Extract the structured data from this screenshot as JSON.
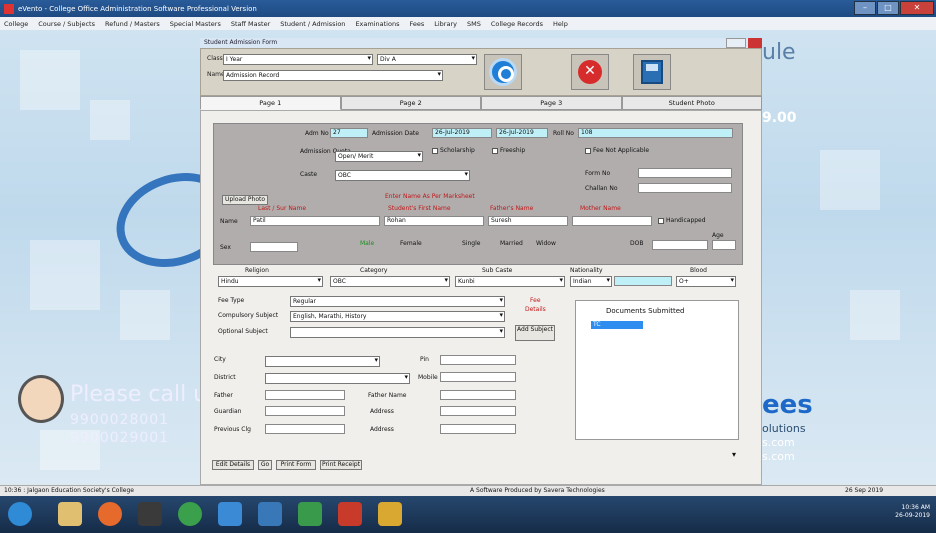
{
  "window": {
    "title": "eVento - College Office Administration Software Professional Version",
    "min": "–",
    "max": "□",
    "close": "✕"
  },
  "menu": [
    "College",
    "Course / Subjects",
    "Refund / Masters",
    "Special Masters",
    "Staff Master",
    "Student / Admission",
    "Examinations",
    "Fees",
    "Library",
    "SMS",
    "College Records",
    "Help"
  ],
  "form": {
    "title": "Student Admission Form"
  },
  "toolbar": {
    "class_label": "Class",
    "class_value": "I Year",
    "div_value": "Div A",
    "student_label": "Name",
    "student_value": "Admission Record",
    "search_icon": "search-icon",
    "cancel_icon": "cancel-icon",
    "save_icon": "save-icon"
  },
  "tabs": [
    "Page 1",
    "Page 2",
    "Page 3",
    "Student Photo"
  ],
  "page1": {
    "admno_label": "Adm No",
    "admno_value": "27",
    "admdate_label": "Admission Date",
    "admdate_value": "26-Jul-2019",
    "date2_value": "26-Jul-2019",
    "rollno_label": "Roll No",
    "rollno_value": "108",
    "quota_label": "Admission Quota",
    "quota_value": "Open/ Merit",
    "chk1": "Scholarship",
    "chk2": "Freeship",
    "chk3": "Fee Not Applicable",
    "cast_label": "Caste",
    "cast_value": "OBC",
    "form_label": "Form No",
    "cheque_label": "Challan No",
    "upload_btn": "Upload Photo",
    "red_note": "Enter Name As Per Marksheet",
    "h_surname": "Last / Sur Name",
    "h_first": "Student's First Name",
    "h_middle": "Father's Name",
    "h_mother": "Mother Name",
    "name_label": "Name",
    "surname": "Patil",
    "firstname": "Rohan",
    "middle": "Suresh",
    "mother": "",
    "handicap": "Handicapped",
    "gender_label": "Sex",
    "dob_label": "DOB",
    "age_label": "Age",
    "r_male": "Male",
    "r_female": "Female",
    "r_single": "Single",
    "r_married": "Married",
    "r_widow": "Widow",
    "religion_label": "Religion",
    "religion_value": "Hindu",
    "category_label": "Category",
    "category_value": "OBC",
    "subcaste_label": "Sub Caste",
    "subcaste_value": "Kunbi",
    "nationality_label": "Nationality",
    "nationality_value": "Indian",
    "blood_label": "Blood",
    "blood_value": "O+",
    "pay_label": "Fee Type",
    "pay_value": "Regular",
    "comp_label": "Compulsory Subject",
    "comp_value": "English, Marathi, History",
    "optional_label": "Optional Subject",
    "red_side1": "Fee",
    "red_side2": "Details",
    "side_btn": "Add Subject",
    "city_label": "City",
    "pin_label": "Pin",
    "dist_label": "District",
    "mob_label": "Mobile",
    "father_label": "Father",
    "father_name": "Father Name",
    "gauss_label": "Guardian",
    "address_label": "Address",
    "addr2_label": "Address",
    "prev_label": "Previous Clg",
    "docs_title": "Documents Submitted",
    "doc1": "TC",
    "bottom_btns": [
      "Edit Details",
      "Go",
      "Print Form",
      "Print Receipt"
    ],
    "bottom_caret": "▾"
  },
  "status": {
    "left": "10:36 : Jalgaon Education Society's College",
    "mid": "A Software Produced by Savera Technologies",
    "right": "26 Sep 2019"
  },
  "taskbar": {
    "time": "10:36 AM",
    "date": "26-09-2019"
  },
  "background": {
    "brand_top": "ule",
    "brand_ver": "9.00",
    "brand_name": "ees",
    "brand_sol": "olutions",
    "brand_web1": "s.com",
    "brand_web2": "s.com",
    "call_text": "Please call u",
    "phone1": "9900028001",
    "phone2": "9900029001"
  }
}
